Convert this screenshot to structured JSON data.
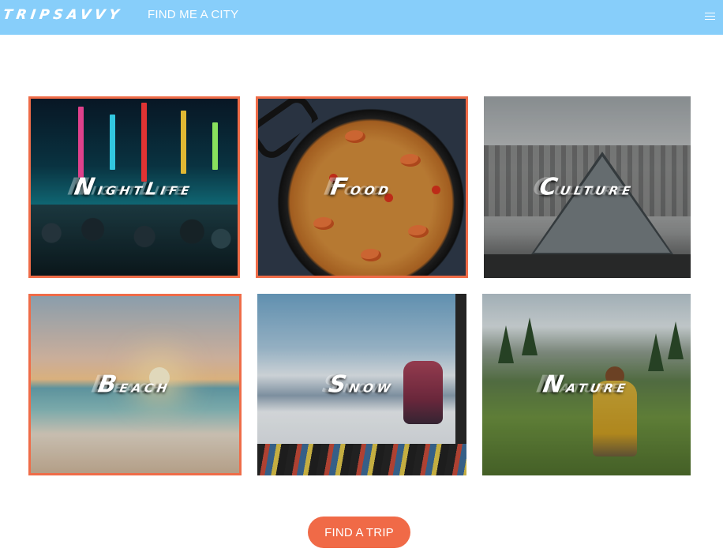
{
  "navbar": {
    "brand": "TRIPSAVVY",
    "link": "FIND ME A CITY",
    "menu_icon": "hamburger-menu-icon",
    "background": "#87cefa"
  },
  "categories": [
    {
      "first": "N",
      "rest": "ightLife",
      "selected": true
    },
    {
      "first": "F",
      "rest": "ood",
      "selected": true
    },
    {
      "first": "C",
      "rest": "ulture",
      "selected": false
    },
    {
      "first": "B",
      "rest": "each",
      "selected": true
    },
    {
      "first": "S",
      "rest": "now",
      "selected": false
    },
    {
      "first": "N",
      "rest": "ature",
      "selected": false
    }
  ],
  "cta": {
    "label": "FIND A TRIP",
    "color": "#f06a47"
  },
  "selected_border_color": "#ef6c48"
}
